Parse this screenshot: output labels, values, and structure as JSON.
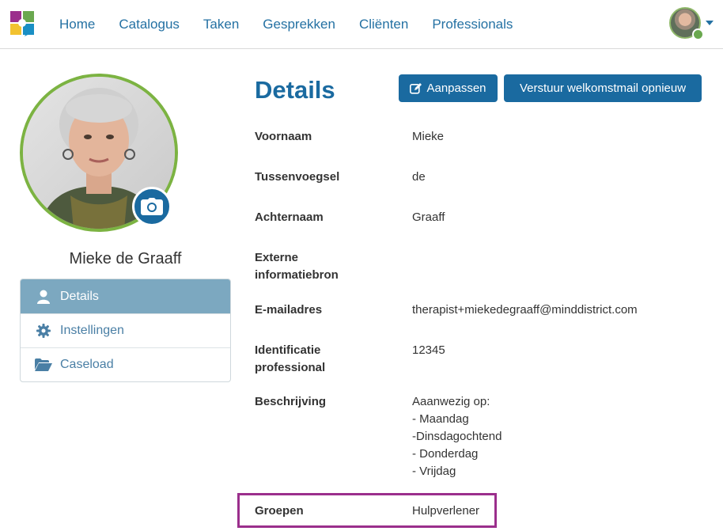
{
  "nav": {
    "items": [
      "Home",
      "Catalogus",
      "Taken",
      "Gesprekken",
      "Cliënten",
      "Professionals"
    ]
  },
  "profile": {
    "name": "Mieke de Graaff"
  },
  "sidebar": {
    "items": [
      {
        "label": "Details",
        "icon": "user-icon",
        "active": true
      },
      {
        "label": "Instellingen",
        "icon": "gear-icon",
        "active": false
      },
      {
        "label": "Caseload",
        "icon": "folder-open-icon",
        "active": false
      }
    ]
  },
  "main": {
    "title": "Details",
    "edit_button": "Aanpassen",
    "resend_button": "Verstuur welkomstmail opnieuw",
    "fields": [
      {
        "label": "Voornaam",
        "value": "Mieke"
      },
      {
        "label": "Tussenvoegsel",
        "value": "de"
      },
      {
        "label": "Achternaam",
        "value": "Graaff"
      },
      {
        "label": "Externe\ninformatiebron",
        "value": ""
      },
      {
        "label": "E-mailadres",
        "value": "therapist+miekedegraaff@minddistrict.com"
      },
      {
        "label": "Identificatie\nprofessional",
        "value": "12345"
      },
      {
        "label": "Beschrijving",
        "value": "Aaanwezig op:\n- Maandag\n-Dinsdagochtend\n- Donderdag\n- Vrijdag"
      },
      {
        "label": "Groepen",
        "value": "Hulpverlener"
      }
    ]
  },
  "colors": {
    "accent": "#1a6aa0",
    "nav_link": "#2471a3",
    "active_menu": "#7ca8c0",
    "photo_ring": "#7cb342",
    "highlight": "#9b2f8c"
  }
}
